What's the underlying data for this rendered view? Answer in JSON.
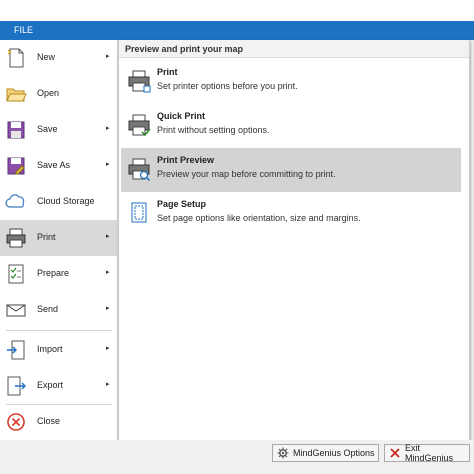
{
  "file_tab": {
    "label": "FILE"
  },
  "menu": {
    "items": [
      {
        "label": "New",
        "icon": "new-document-icon",
        "has_submenu": true
      },
      {
        "label": "Open",
        "icon": "folder-open-icon",
        "has_submenu": false
      },
      {
        "label": "Save",
        "icon": "save-disk-icon",
        "has_submenu": true
      },
      {
        "label": "Save As",
        "icon": "save-as-icon",
        "has_submenu": true
      },
      {
        "label": "Cloud Storage",
        "icon": "cloud-icon",
        "has_submenu": false
      },
      {
        "label": "Print",
        "icon": "printer-icon",
        "has_submenu": true,
        "selected": true
      },
      {
        "label": "Prepare",
        "icon": "prepare-checklist-icon",
        "has_submenu": true
      },
      {
        "label": "Send",
        "icon": "send-mail-icon",
        "has_submenu": true
      },
      {
        "label": "Import",
        "icon": "import-icon",
        "has_submenu": true
      },
      {
        "label": "Export",
        "icon": "export-icon",
        "has_submenu": true
      },
      {
        "label": "Close",
        "icon": "close-circle-icon",
        "has_submenu": false
      }
    ]
  },
  "submenu": {
    "header": "Preview and print your map",
    "items": [
      {
        "title": "Print",
        "desc": "Set printer options before you print.",
        "icon": "printer-icon"
      },
      {
        "title": "Quick Print",
        "desc": "Print without setting options.",
        "icon": "quick-print-icon"
      },
      {
        "title": "Print Preview",
        "desc": "Preview your map before committing to print.",
        "icon": "print-preview-icon",
        "selected": true
      },
      {
        "title": "Page Setup",
        "desc": "Set page options like orientation, size and margins.",
        "icon": "page-setup-icon"
      }
    ]
  },
  "footer": {
    "options_label": "MindGenius Options",
    "exit_label": "Exit MindGenius"
  },
  "colors": {
    "accent": "#1e72c4",
    "selected_bg": "#d9d9d9"
  }
}
